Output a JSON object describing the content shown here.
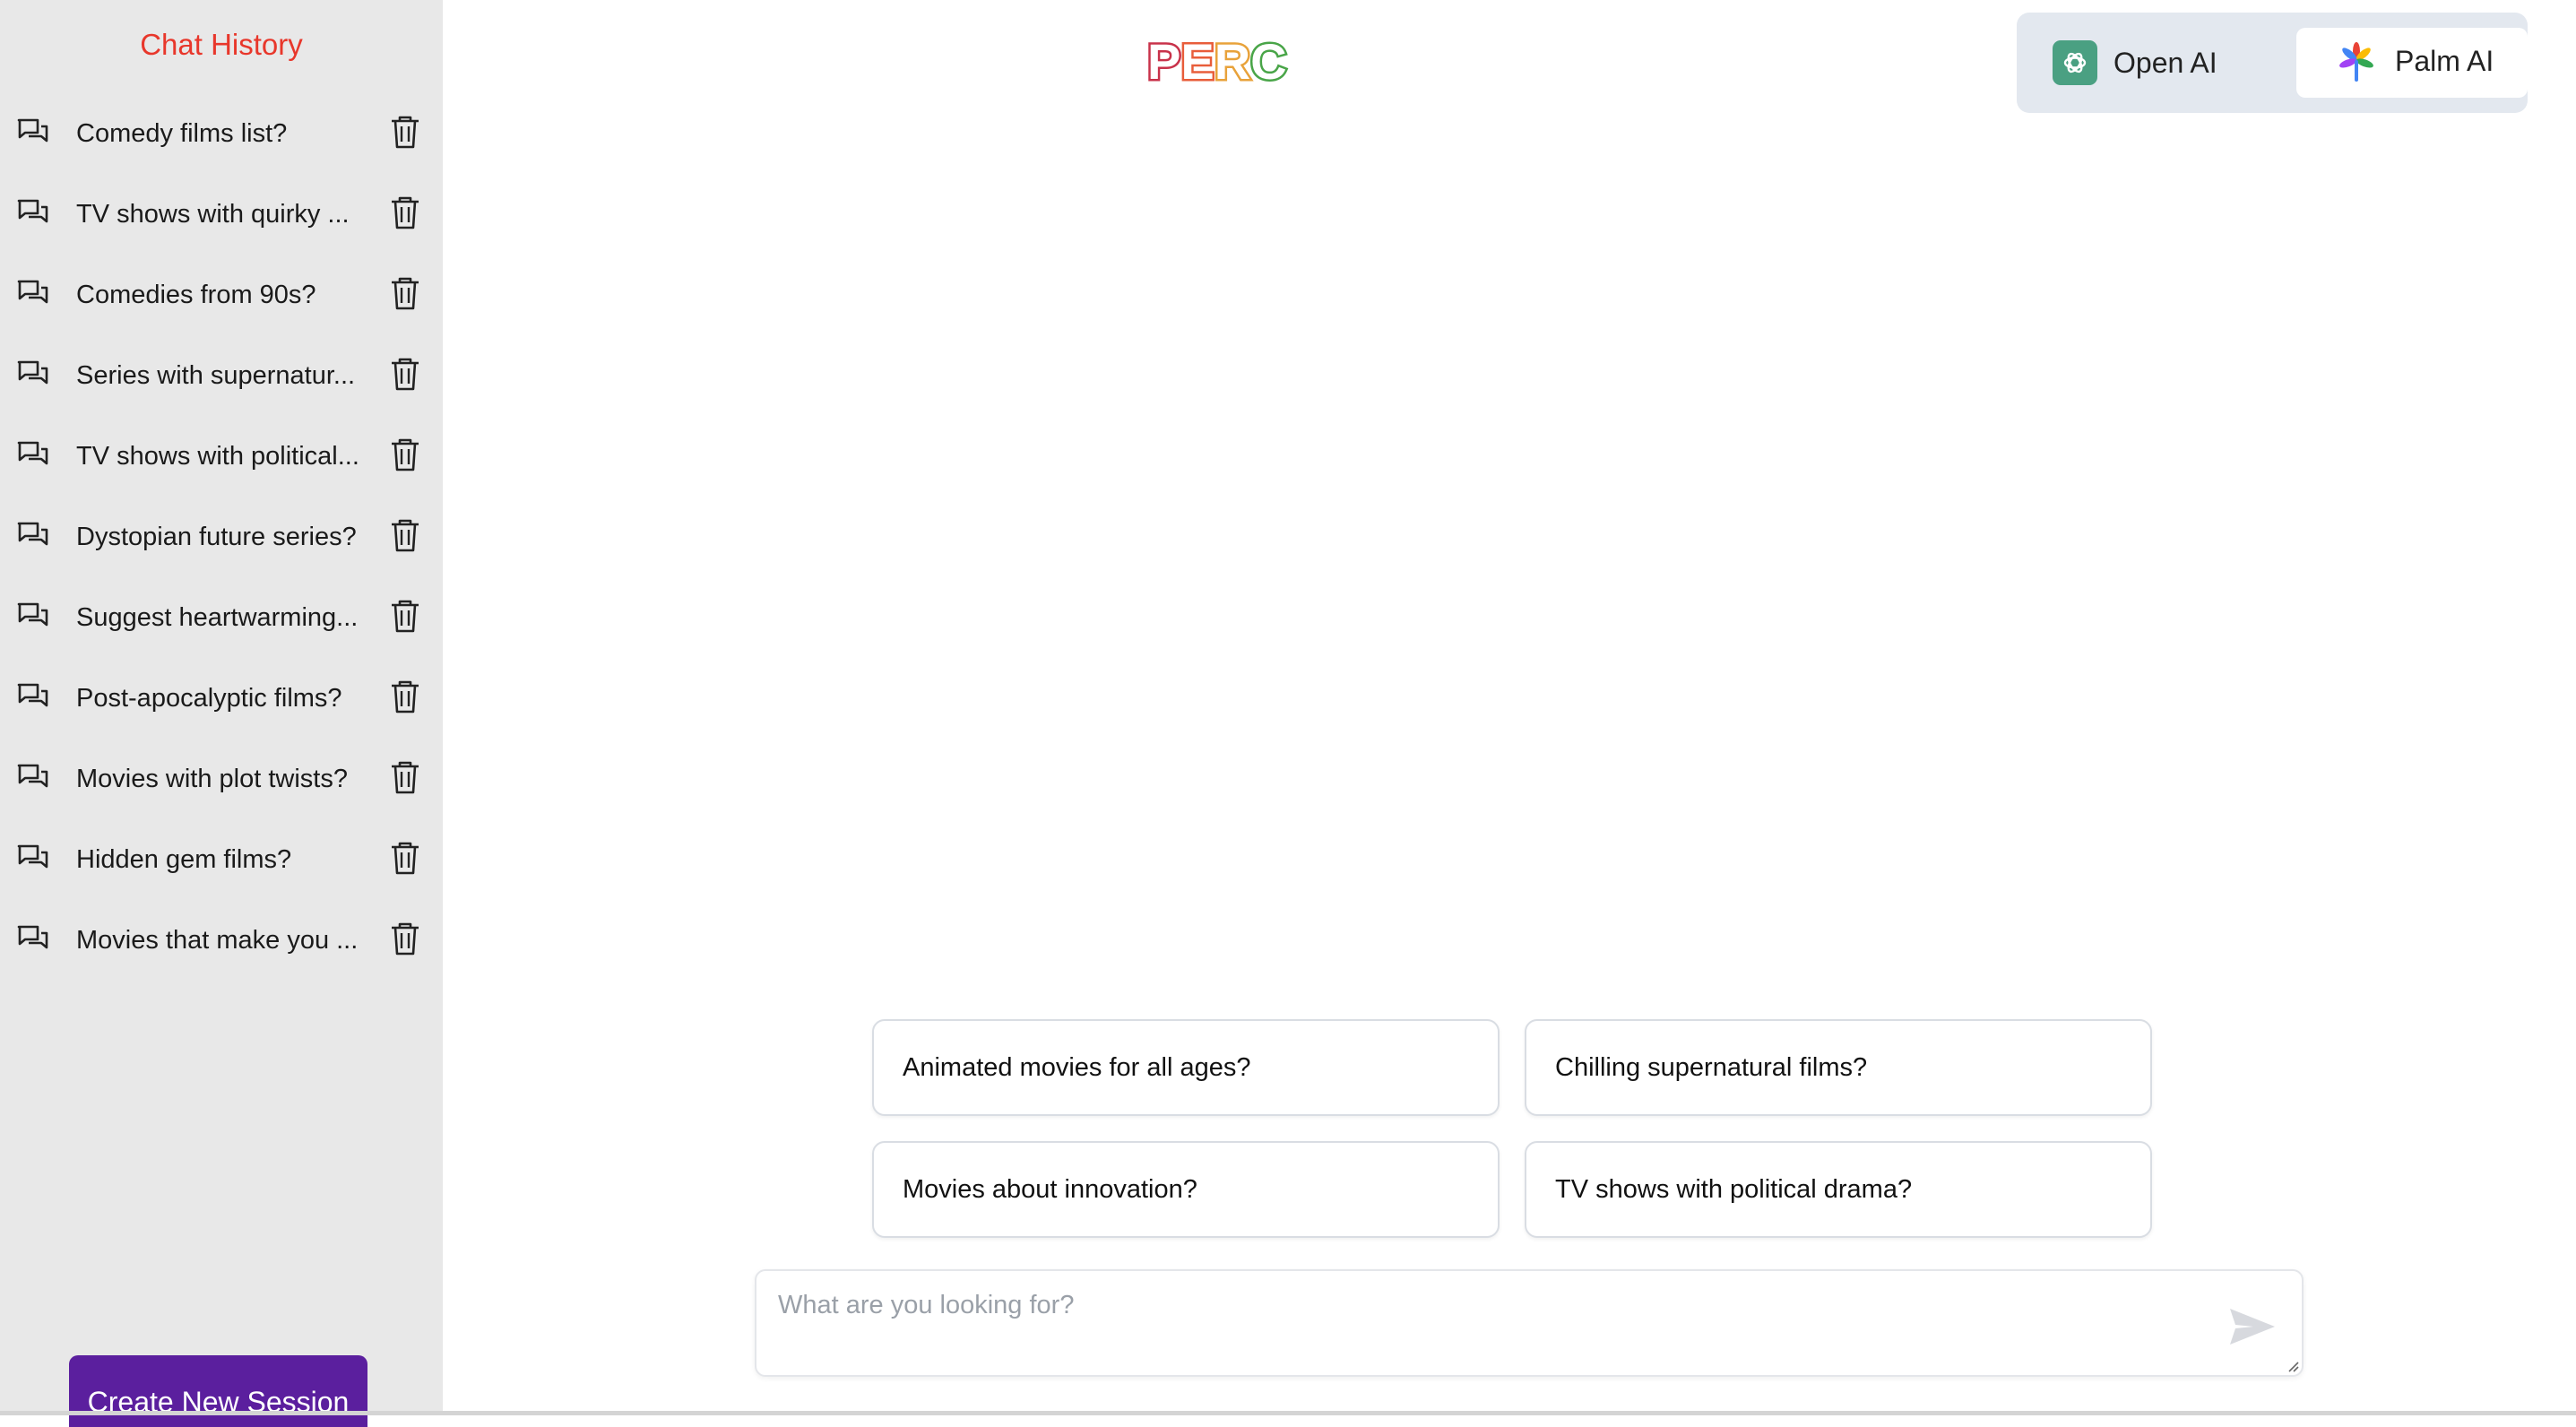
{
  "sidebar": {
    "title": "Chat History",
    "sessions": [
      {
        "label": "Comedy films list?"
      },
      {
        "label": "TV shows with quirky ..."
      },
      {
        "label": "Comedies from 90s?"
      },
      {
        "label": "Series with supernatur..."
      },
      {
        "label": "TV shows with political..."
      },
      {
        "label": "Dystopian future series?"
      },
      {
        "label": "Suggest heartwarming..."
      },
      {
        "label": "Post-apocalyptic films?"
      },
      {
        "label": "Movies with plot twists?"
      },
      {
        "label": "Hidden gem films?"
      },
      {
        "label": "Movies that make you ..."
      }
    ],
    "new_session_label": "Create New Session"
  },
  "header": {
    "logo_text": "PERC",
    "models": [
      {
        "label": "Open AI",
        "icon": "openai-icon",
        "selected": false
      },
      {
        "label": "Palm AI",
        "icon": "palm-icon",
        "selected": true
      }
    ]
  },
  "suggestions": [
    "Animated movies for all ages?",
    "Chilling supernatural films?",
    "Movies about innovation?",
    "TV shows with political drama?"
  ],
  "composer": {
    "placeholder": "What are you looking for?",
    "value": ""
  },
  "colors": {
    "accent_purple": "#5b1f9e",
    "title_red": "#e8372b",
    "sidebar_bg": "#e8e8e8",
    "openai_green": "#4aa082"
  }
}
